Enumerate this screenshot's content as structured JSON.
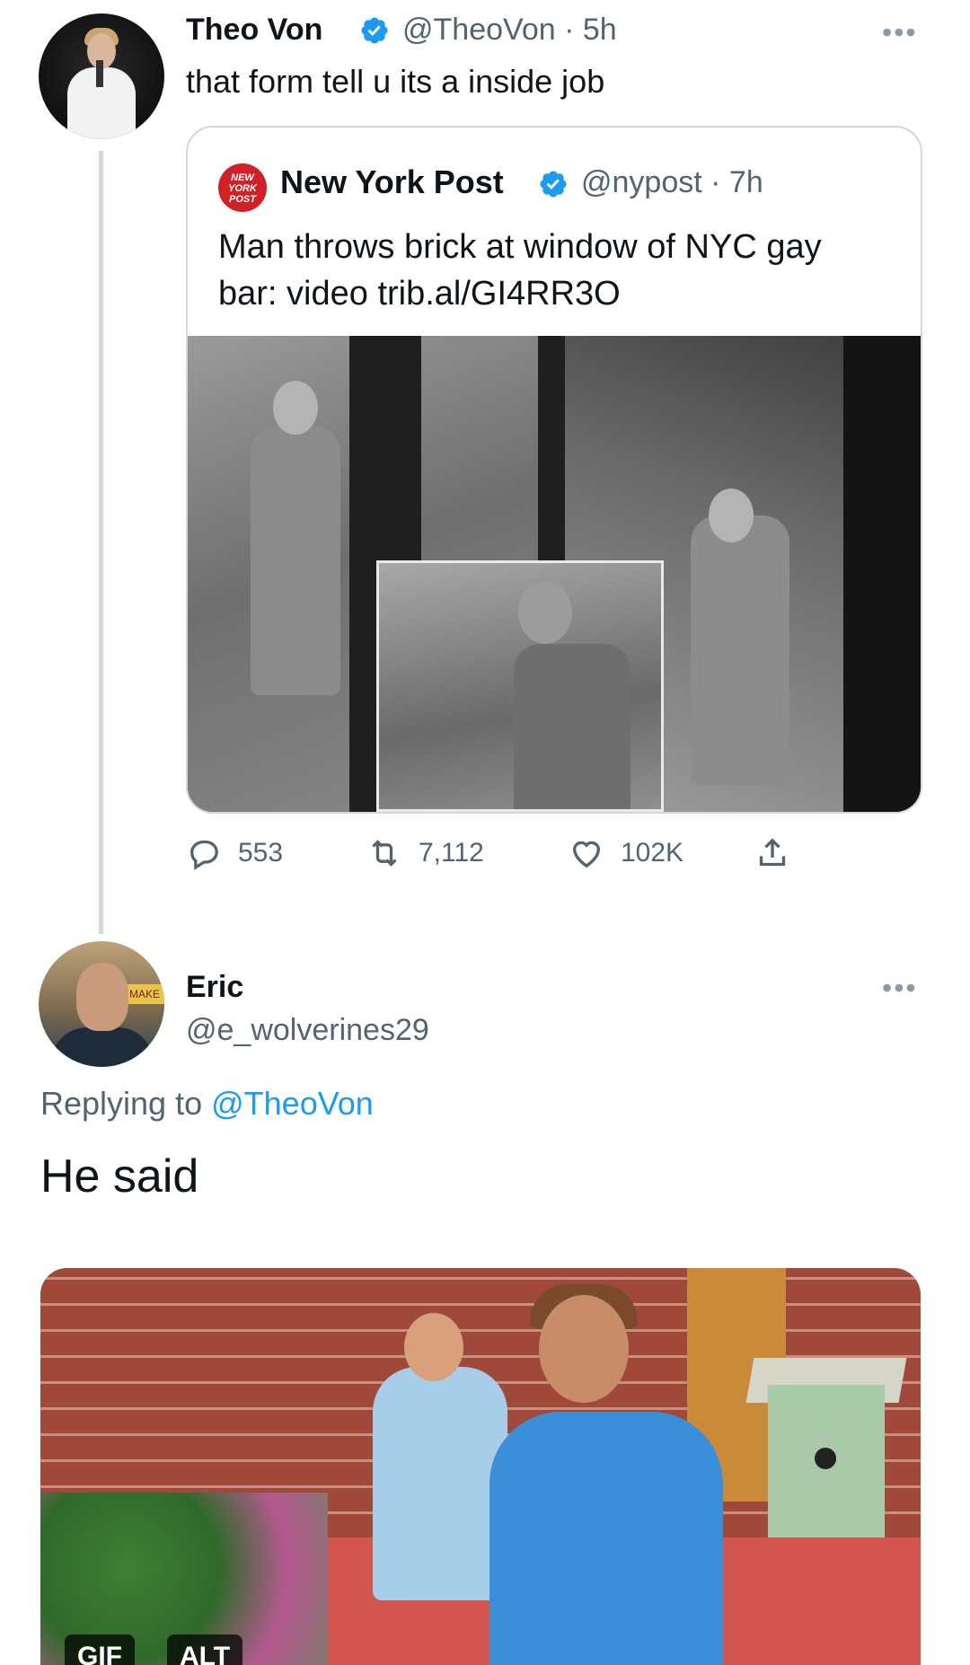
{
  "tweet": {
    "author_name": "Theo Von",
    "author_handle": "@TheoVon · 5h",
    "text": "that form tell u its a inside job",
    "more": "•••",
    "quote": {
      "logo_text": "NEW YORK POST",
      "author_name": "New York Post",
      "author_handle": "@nypost · 7h",
      "text_line1": "Man throws brick at window of NYC gay",
      "text_line2": "bar: video trib.al/GI4RR3O"
    },
    "stats": {
      "replies": "553",
      "retweets": "7,112",
      "likes": "102K"
    }
  },
  "reply": {
    "author_name": "Eric",
    "author_handle": "@e_wolverines29",
    "more": "•••",
    "replying_prefix": "Replying to ",
    "replying_mention": "@TheoVon",
    "text": "He said",
    "avatar_sign_text": "MAKE",
    "media_badges": [
      "GIF",
      "ALT"
    ]
  },
  "colors": {
    "link_blue": "#1d9bf0",
    "secondary_text": "#536471",
    "verified_blue": "#1d9bf0",
    "nypost_red": "#d31f26"
  },
  "icons": [
    "verified-icon",
    "reply-icon",
    "retweet-icon",
    "like-icon",
    "share-icon",
    "more-icon"
  ]
}
